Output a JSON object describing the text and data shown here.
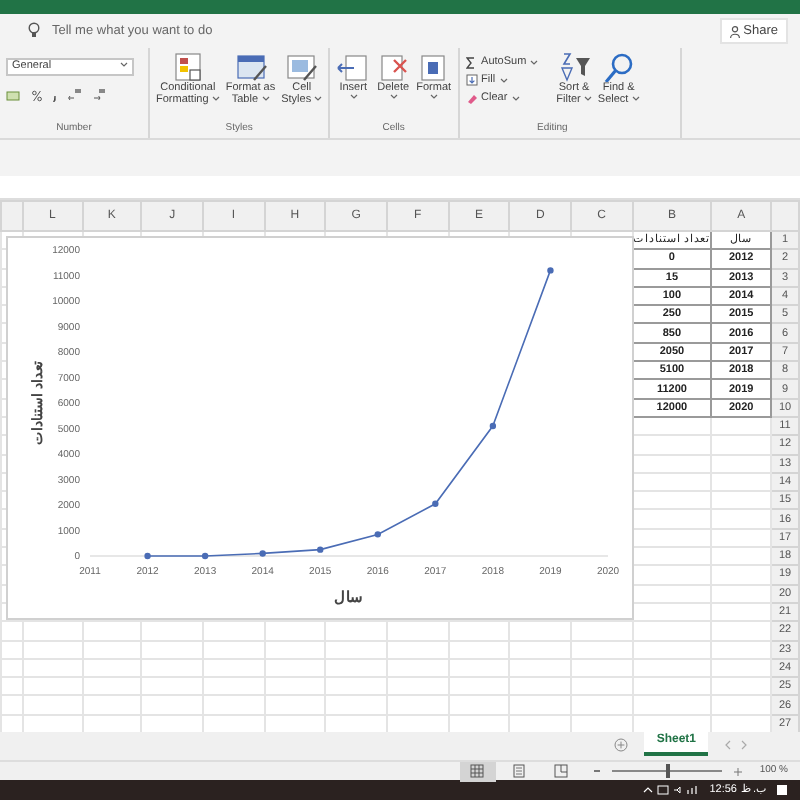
{
  "tell_me": {
    "placeholder": "Tell me what you want to do"
  },
  "share_button": "Share",
  "ribbon": {
    "groups": [
      {
        "kind": "number",
        "label": "Number",
        "format_field": "General"
      },
      {
        "kind": "large",
        "label": "Styles",
        "buttons": [
          {
            "lines": [
              "Conditional",
              "Formatting"
            ]
          },
          {
            "lines": [
              "Format as",
              "Table"
            ]
          },
          {
            "lines": [
              "Cell",
              "Styles"
            ]
          }
        ]
      },
      {
        "kind": "large",
        "label": "Cells",
        "buttons": [
          {
            "lines": [
              "Insert"
            ]
          },
          {
            "lines": [
              "Delete"
            ]
          },
          {
            "lines": [
              "Format"
            ]
          }
        ]
      },
      {
        "kind": "editing",
        "label": "Editing",
        "small_buttons": [
          "AutoSum",
          "Fill",
          "Clear"
        ],
        "buttons": [
          {
            "lines": [
              "Sort &",
              "Filter"
            ]
          },
          {
            "lines": [
              "Find &",
              "Select"
            ]
          }
        ]
      }
    ]
  },
  "sheet": {
    "column_letters": [
      "L",
      "K",
      "J",
      "I",
      "H",
      "G",
      "F",
      "E",
      "D",
      "C",
      "B",
      "A"
    ],
    "row_numbers": [
      "1",
      "2",
      "3",
      "4",
      "5",
      "6",
      "7",
      "8",
      "9",
      "10",
      "11",
      "12",
      "13",
      "14",
      "15",
      "16",
      "17",
      "18",
      "19",
      "20",
      "21",
      "22",
      "23",
      "24",
      "25",
      "26",
      "27"
    ],
    "header_row": [
      "سال",
      "تعداد استنادات"
    ],
    "data_rows": [
      [
        "0",
        "2012"
      ],
      [
        "15",
        "2013"
      ],
      [
        "100",
        "2014"
      ],
      [
        "250",
        "2015"
      ],
      [
        "850",
        "2016"
      ],
      [
        "2050",
        "2017"
      ],
      [
        "5100",
        "2018"
      ],
      [
        "11200",
        "2019"
      ],
      [
        "12000",
        "2020"
      ]
    ]
  },
  "chart_data": {
    "type": "line",
    "xlabel": "سال",
    "ylabel": "تعداد استنادات",
    "x": [
      2012,
      2013,
      2014,
      2015,
      2016,
      2017,
      2018,
      2019
    ],
    "series": [
      {
        "color": "#4a6cb5",
        "marker": true,
        "values": [
          0,
          0,
          100,
          250,
          850,
          2050,
          5100,
          11200
        ]
      }
    ],
    "xlim": [
      2011,
      2020
    ],
    "ylim": [
      0,
      12000
    ],
    "xticks": [
      2011,
      2012,
      2013,
      2014,
      2015,
      2016,
      2017,
      2018,
      2019,
      2020
    ],
    "yticks": [
      0,
      1000,
      2000,
      3000,
      4000,
      5000,
      6000,
      7000,
      8000,
      9000,
      10000,
      11000,
      12000
    ]
  },
  "sheet_tabs": [
    {
      "label": "Sheet1",
      "selected": true
    }
  ],
  "views": [
    {
      "selected": true
    },
    {
      "selected": false
    },
    {
      "selected": false
    }
  ],
  "zoom": {
    "level": 0.5,
    "reading": "100 %"
  },
  "taskbar": {
    "time": "12:56",
    "period": "ب.ظ"
  }
}
